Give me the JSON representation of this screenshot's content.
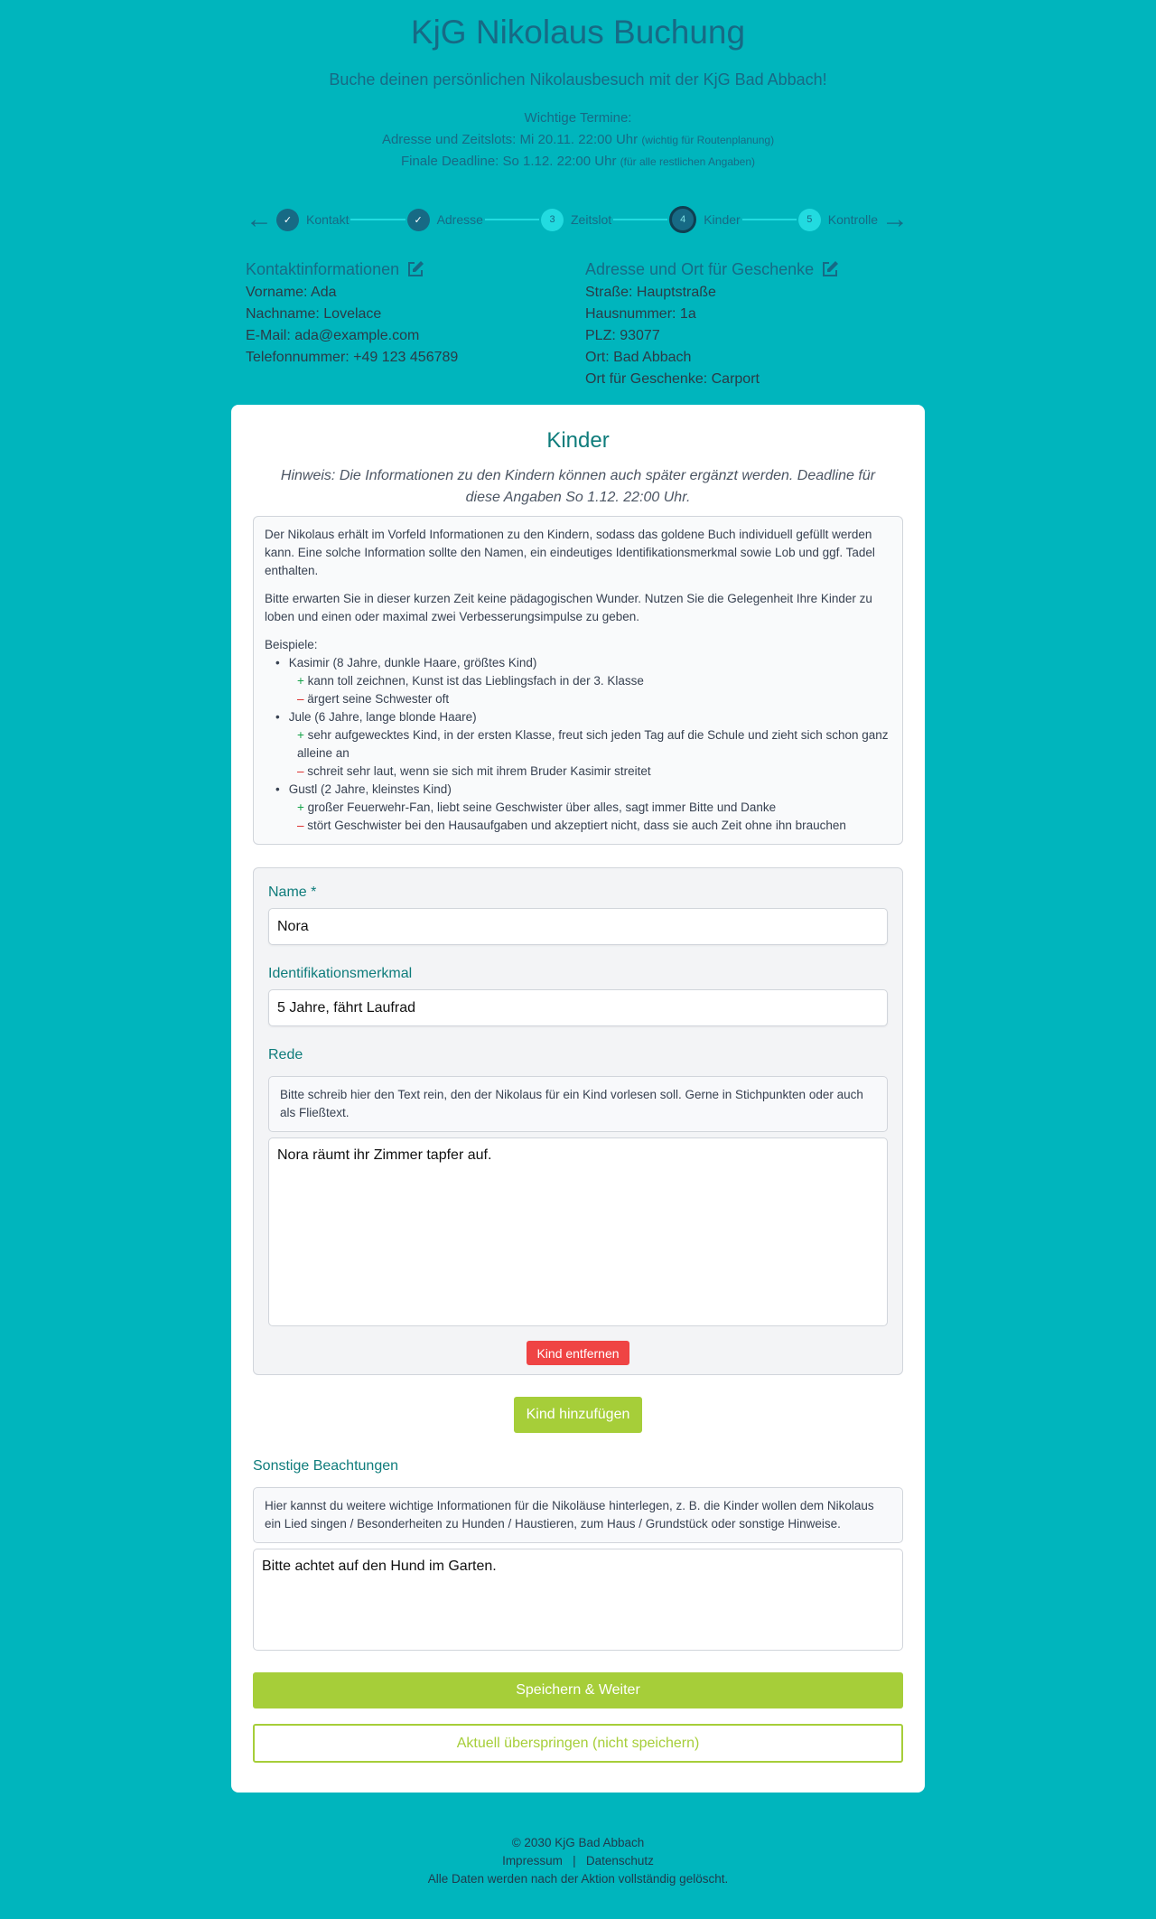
{
  "header": {
    "title": "KjG Nikolaus Buchung",
    "subtitle": "Buche deinen persönlichen Nikolausbesuch mit der KjG Bad Abbach!",
    "dates_label": "Wichtige Termine:",
    "date1": "Adresse und Zeitslots: Mi 20.11. 22:00 Uhr",
    "date1_note": "(wichtig für Routenplanung)",
    "date2": "Finale Deadline: So 1.12. 22:00 Uhr",
    "date2_note": "(für alle restlichen Angaben)"
  },
  "stepper": {
    "steps": [
      {
        "label": "Kontakt",
        "state": "done"
      },
      {
        "label": "Adresse",
        "state": "done"
      },
      {
        "num": "3",
        "label": "Zeitslot",
        "state": "todo"
      },
      {
        "num": "4",
        "label": "Kinder",
        "state": "current"
      },
      {
        "num": "5",
        "label": "Kontrolle",
        "state": "todo"
      }
    ],
    "prev_icon": "arrow-left",
    "next_icon": "arrow-right"
  },
  "contact": {
    "title": "Kontaktinformationen",
    "lines": [
      "Vorname: Ada",
      "Nachname: Lovelace",
      "E-Mail: ada@example.com",
      "Telefonnummer: +49 123 456789"
    ]
  },
  "address": {
    "title": "Adresse und Ort für Geschenke",
    "lines": [
      "Straße: Hauptstraße",
      "Hausnummer: 1a",
      "PLZ: 93077",
      "Ort: Bad Abbach",
      "Ort für Geschenke: Carport"
    ]
  },
  "card": {
    "title": "Kinder",
    "hint": "Hinweis: Die Informationen zu den Kindern können auch später ergänzt werden. Deadline für diese Angaben So 1.12. 22:00 Uhr.",
    "info_p1": "Der Nikolaus erhält im Vorfeld Informationen zu den Kindern, sodass das goldene Buch individuell gefüllt werden kann. Eine solche Information sollte den Namen, ein eindeutiges Identifikationsmerkmal sowie Lob und ggf. Tadel enthalten.",
    "info_p2": "Bitte erwarten Sie in dieser kurzen Zeit keine pädagogischen Wunder. Nutzen Sie die Gelegenheit Ihre Kinder zu loben und einen oder maximal zwei Verbesserungsimpulse zu geben.",
    "examples_label": "Beispiele:",
    "examples": [
      {
        "name": "Kasimir (8 Jahre, dunkle Haare, größtes Kind)",
        "plus": "kann toll zeichnen, Kunst ist das Lieblingsfach in der 3. Klasse",
        "minus": "ärgert seine Schwester oft"
      },
      {
        "name": "Jule (6 Jahre, lange blonde Haare)",
        "plus": "sehr aufgewecktes Kind, in der ersten Klasse, freut sich jeden Tag auf die Schule und zieht sich schon ganz alleine an",
        "minus": "schreit sehr laut, wenn sie sich mit ihrem Bruder Kasimir streitet"
      },
      {
        "name": "Gustl (2 Jahre, kleinstes Kind)",
        "plus": "großer Feuerwehr-Fan, liebt seine Geschwister über alles, sagt immer Bitte und Danke",
        "minus": "stört Geschwister bei den Hausaufgaben und akzeptiert nicht, dass sie auch Zeit ohne ihn brauchen"
      }
    ],
    "child": {
      "name_label": "Name *",
      "name_value": "Nora",
      "ident_label": "Identifikationsmerkmal",
      "ident_value": "5 Jahre, fährt Laufrad",
      "speech_label": "Rede",
      "speech_hint": "Bitte schreib hier den Text rein, den der Nikolaus für ein Kind vorlesen soll. Gerne in Stichpunkten oder auch als Fließtext.",
      "speech_value": "Nora räumt ihr Zimmer tapfer auf.",
      "remove_label": "Kind entfernen"
    },
    "add_label": "Kind hinzufügen",
    "other_label": "Sonstige Beachtungen",
    "other_hint": "Hier kannst du weitere wichtige Informationen für die Nikoläuse hinterlegen, z. B. die Kinder wollen dem Nikolaus ein Lied singen / Besonderheiten zu Hunden / Haustieren, zum Haus / Grundstück oder sonstige Hinweise.",
    "other_value": "Bitte achtet auf den Hund im Garten.",
    "save_label": "Speichern & Weiter",
    "skip_label": "Aktuell überspringen (nicht speichern)"
  },
  "footer": {
    "copyright": "© 2030 KjG Bad Abbach",
    "impressum": "Impressum",
    "sep": "|",
    "datenschutz": "Datenschutz",
    "note": "Alle Daten werden nach der Aktion vollständig gelöscht."
  },
  "colors": {
    "background": "#00b5bd",
    "accent": "#a6ce39",
    "danger": "#ef4444",
    "heading": "#0e7c7b"
  }
}
